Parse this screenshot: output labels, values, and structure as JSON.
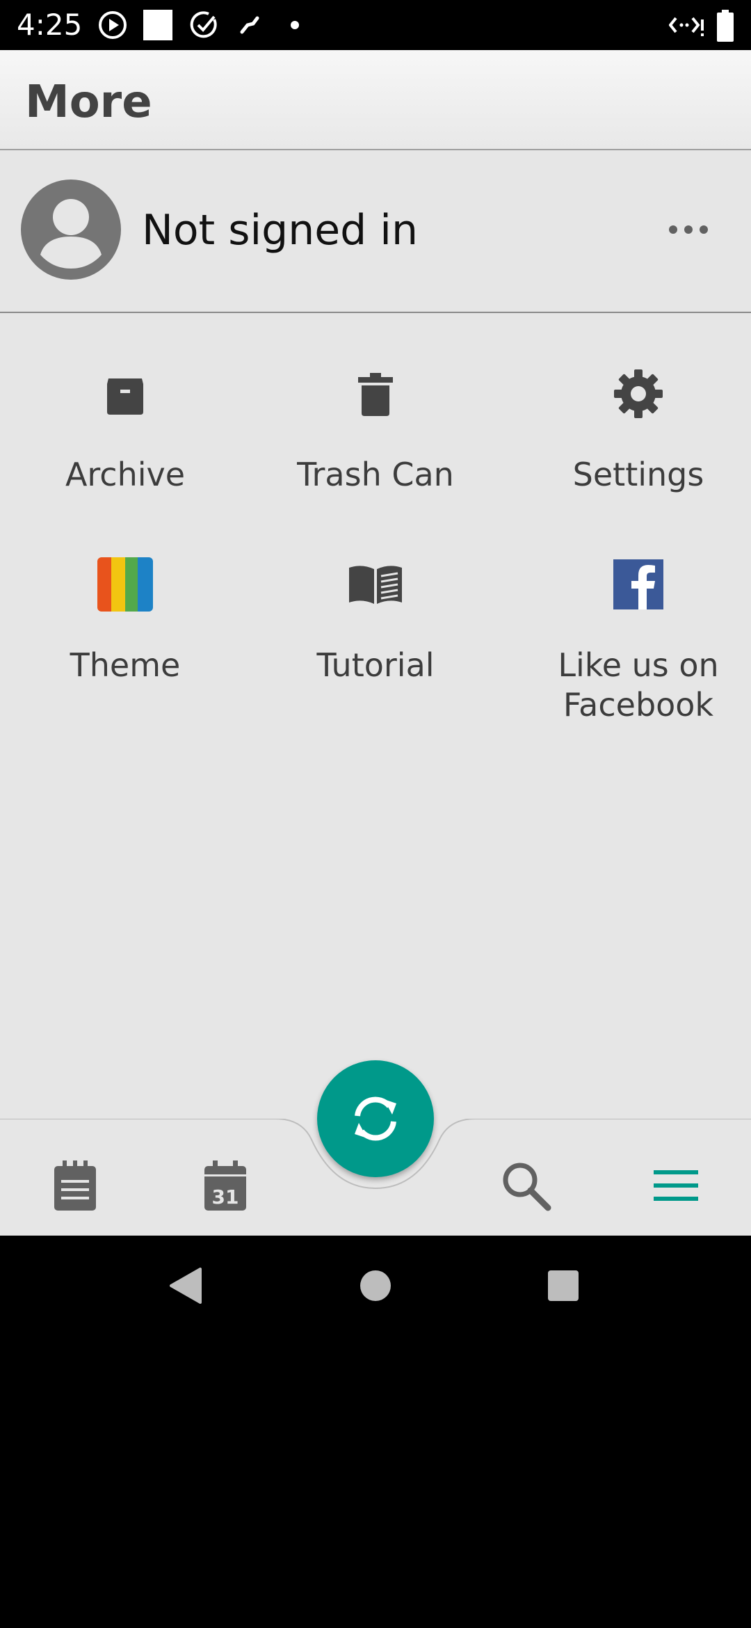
{
  "status_bar": {
    "time": "4:25",
    "icons": [
      "play-circle-icon",
      "white-square-icon",
      "check-circle-icon",
      "fan-icon",
      "dot-icon",
      "vibrate-signal-icon",
      "battery-icon"
    ]
  },
  "app_bar": {
    "title": "More"
  },
  "account": {
    "name": "Not signed in",
    "avatar_icon": "account-circle-icon",
    "menu_icon": "more-horizontal-icon"
  },
  "grid": [
    {
      "label": "Archive",
      "icon": "archive-icon"
    },
    {
      "label": "Trash Can",
      "icon": "trash-icon"
    },
    {
      "label": "Settings",
      "icon": "gear-icon"
    },
    {
      "label": "Theme",
      "icon": "color-stripes-icon",
      "colors": [
        "#e8531c",
        "#f2c511",
        "#53a94a",
        "#1d82c6"
      ]
    },
    {
      "label": "Tutorial",
      "icon": "open-book-icon"
    },
    {
      "label_line1": "Like us on",
      "label_line2": "Facebook",
      "icon": "facebook-icon",
      "color": "#3b5998"
    }
  ],
  "bottom_nav": {
    "items": [
      "notes-icon",
      "calendar-icon",
      "search-icon",
      "menu-icon"
    ],
    "calendar_day": "31",
    "active": "menu-icon",
    "accent": "#00998a"
  },
  "fab": {
    "icon": "sync-icon",
    "color": "#00998a"
  },
  "system_nav": [
    "back-icon",
    "home-icon",
    "recents-icon"
  ]
}
